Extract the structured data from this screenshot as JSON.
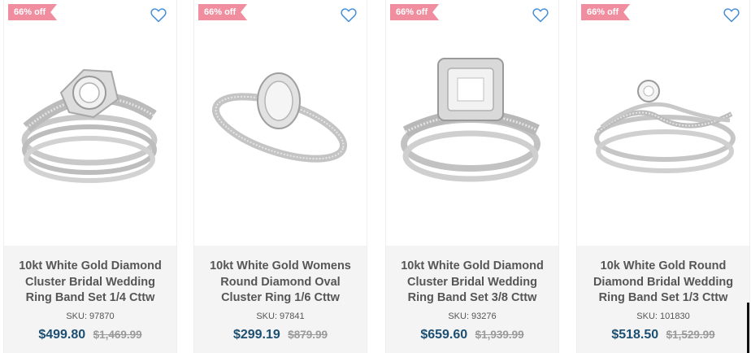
{
  "colors": {
    "badge": "#f08ea0",
    "heart": "#4a90d9",
    "price": "#1d4f73",
    "old_price": "#9a9a9a",
    "title": "#565656"
  },
  "products": [
    {
      "badge": "66% off",
      "wishlist_icon": "heart-outline-icon",
      "title": "10kt White Gold Diamond Cluster Bridal Wedding Ring Band Set 1/4 Cttw",
      "sku": "SKU: 97870",
      "price": "$499.80",
      "old_price": "$1,469.99"
    },
    {
      "badge": "66% off",
      "wishlist_icon": "heart-outline-icon",
      "title": "10kt White Gold Womens Round Diamond Oval Cluster Ring 1/6 Cttw",
      "sku": "SKU: 97841",
      "price": "$299.19",
      "old_price": "$879.99"
    },
    {
      "badge": "66% off",
      "wishlist_icon": "heart-outline-icon",
      "title": "10kt White Gold Diamond Cluster Bridal Wedding Ring Band Set 3/8 Cttw",
      "sku": "SKU: 93276",
      "price": "$659.60",
      "old_price": "$1,939.99"
    },
    {
      "badge": "66% off",
      "wishlist_icon": "heart-outline-icon",
      "title": "10k White Gold Round Diamond Bridal Wedding Ring Band Set 1/3 Cttw",
      "sku": "SKU: 101830",
      "price": "$518.50",
      "old_price": "$1,529.99"
    }
  ]
}
